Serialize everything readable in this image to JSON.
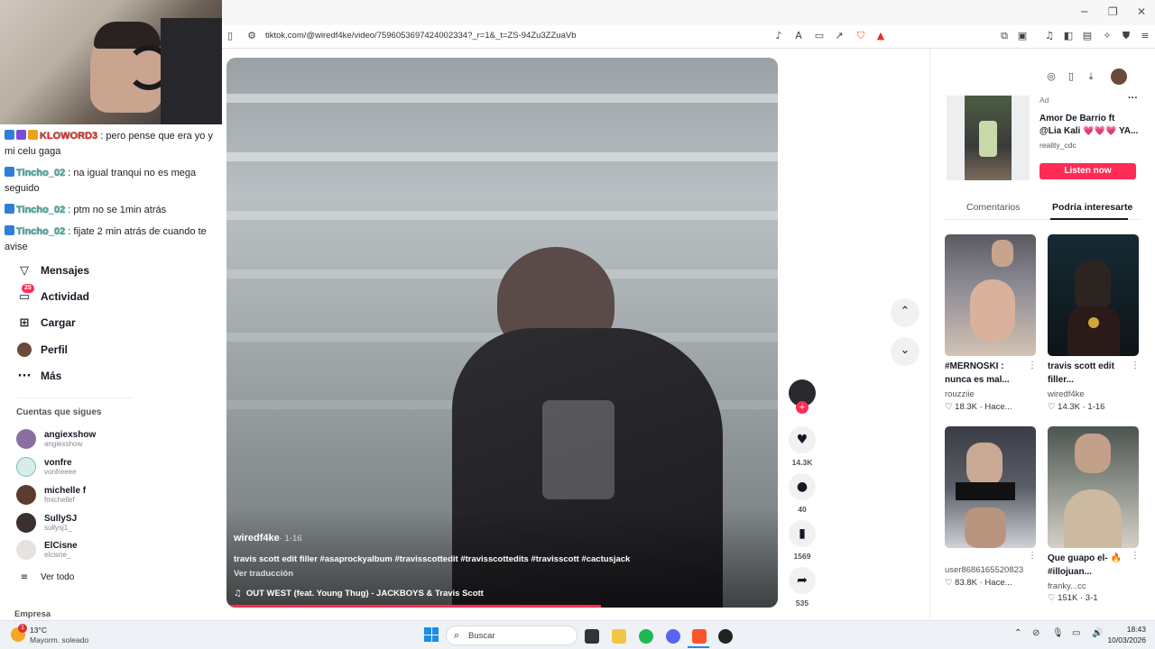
{
  "browser": {
    "url": "tiktok.com/@wiredf4ke/video/7596053697424002334?_r=1&_t=ZS-94Zu3ZZuaVb"
  },
  "chat": {
    "messages": [
      {
        "user": "KLOWORD3",
        "text": ": pero pense que era yo y mi celu gaga"
      },
      {
        "user": "Tincho_02",
        "text": ": na igual tranqui no es mega seguido"
      },
      {
        "user": "Tincho_02",
        "text": ": ptm no se 1min atrás"
      },
      {
        "user": "Tincho_02",
        "text": ": fijate 2 min atrás de cuando te avise"
      }
    ]
  },
  "sidebar": {
    "nav": [
      {
        "label": "Mensajes",
        "icon": "paper-plane-icon"
      },
      {
        "label": "Actividad",
        "icon": "inbox-icon",
        "badge": "25"
      },
      {
        "label": "Cargar",
        "icon": "plus-square-icon"
      },
      {
        "label": "Perfil",
        "icon": "avatar-icon"
      },
      {
        "label": "Más",
        "icon": "more-icon"
      }
    ],
    "following_title": "Cuentas que sigues",
    "accounts": [
      {
        "name": "angiexshow",
        "handle": "angiexshow",
        "color": "#8a6fa0"
      },
      {
        "name": "vonfre",
        "handle": "vonfreeee",
        "color": "#d8ecec"
      },
      {
        "name": "michelle f",
        "handle": "fmichellef",
        "color": "#5a3d2e"
      },
      {
        "name": "SullySJ",
        "handle": "sullysj1_",
        "color": "#3a3030"
      },
      {
        "name": "ElCisne",
        "handle": "elcisne_",
        "color": "#e5e2e0"
      }
    ],
    "see_all": "Ver todo",
    "footer": "Empresa"
  },
  "video": {
    "author": "wiredf4ke",
    "date": "· 1-16",
    "caption": "travis scott edit filler #asaprockyalbum #travisscottedit #travisscottedits #travisscott #cactusjack",
    "translate": "Ver traducción",
    "music": "OUT WEST (feat. Young Thug) - JACKBOYS & Travis Scott",
    "progress": 0.68
  },
  "actions": {
    "likes": "14.3K",
    "comments": "40",
    "saves": "1569",
    "shares": "535"
  },
  "ad": {
    "label": "Ad",
    "title": "Amor De Barrio ft @Lia Kali 💗💗💗 YA...",
    "account": "reality_cdc",
    "cta": "Listen now",
    "cta_color": "#fe2c55"
  },
  "tabs": {
    "comments": "Comentarios",
    "suggested": "Podría interesarte"
  },
  "suggestions": [
    {
      "title": "#MERNOSKI : nunca es mal...",
      "author": "rouzziie",
      "stats": "♡ 18.3K · Hace..."
    },
    {
      "title": "travis scott edit filler...",
      "author": "wiredf4ke",
      "stats": "♡ 14.3K · 1-16"
    },
    {
      "title": "",
      "author": "user8686165520823",
      "stats": "♡ 83.8K · Hace..."
    },
    {
      "title": "Que guapo el- 🔥 #illojuan...",
      "author": "franky...cc",
      "stats": "♡ 151K · 3-1"
    }
  ],
  "taskbar": {
    "weather_temp": "13°C",
    "weather_desc": "Mayorm. soleado",
    "search_placeholder": "Buscar",
    "time": "18:43",
    "date": "10/03/2026"
  }
}
